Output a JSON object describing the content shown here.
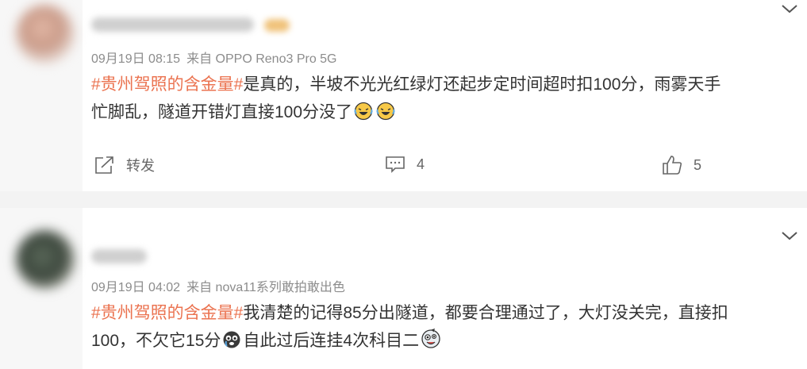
{
  "posts": [
    {
      "meta": {
        "date": "09月19日 08:15",
        "source": "来自 OPPO Reno3 Pro 5G"
      },
      "hashtag": "#贵州驾照的含金量#",
      "line1": "是真的，半坡不光光红绿灯还起步定时间超时扣100分，雨雾天手",
      "line2": "忙脚乱，隧道开错灯直接100分没了",
      "emojis": [
        "laugh-cry-emoji",
        "laugh-cry-emoji"
      ],
      "actions": {
        "repost": "转发",
        "comments": "4",
        "likes": "5"
      }
    },
    {
      "meta": {
        "date": "09月19日 04:02",
        "source": "来自 nova11系列敢拍敢出色"
      },
      "hashtag": "#贵州驾照的含金量#",
      "line1": "我清楚的记得85分出隧道，都要合理通过了，大灯没关完，直接扣",
      "line2a": "100，不欠它15分",
      "line2b": "自此过后连挂4次科目二",
      "emojis": [
        "crying-face-emoji",
        "crazy-face-emoji"
      ]
    }
  ],
  "colors": {
    "hashtag": "#eb7350",
    "text": "#333333",
    "meta": "#8c8c8c"
  }
}
